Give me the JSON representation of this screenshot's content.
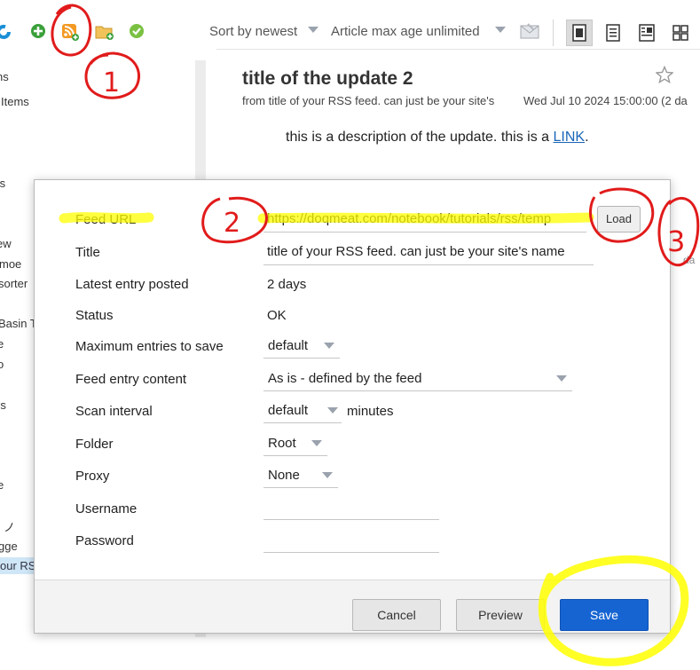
{
  "toolbar": {
    "sort_label": "Sort by newest",
    "age_label": "Article max age unlimited"
  },
  "sidebar": {
    "items": [
      {
        "label": "ns"
      },
      {
        "label": "Items"
      },
      {
        "label": "ts"
      },
      {
        "label": "ew"
      },
      {
        "label": "moe"
      },
      {
        "label": "sorter"
      },
      {
        "label": "t"
      },
      {
        "label": "Basin T"
      },
      {
        "label": "e"
      },
      {
        "label": "o"
      },
      {
        "label": "rs"
      },
      {
        "label": "e"
      },
      {
        "label": ") ノ"
      },
      {
        "label": "gge"
      },
      {
        "label": "our RS"
      }
    ]
  },
  "article": {
    "title": "title of the update 2",
    "source": "from title of your RSS feed. can just be your site's",
    "date": "Wed Jul 10 2024 15:00:00 (2 da",
    "body_text": "this is a description of the update. this is a ",
    "body_link": "LINK",
    "body_end": ".",
    "right_fragment": "da"
  },
  "dialog": {
    "rows": {
      "feed_url": {
        "label": "Feed URL",
        "value": "https://doqmeat.com/notebook/tutorials/rss/temp"
      },
      "title": {
        "label": "Title",
        "value": "title of your RSS feed. can just be your site's name"
      },
      "latest": {
        "label": "Latest entry posted",
        "value": "2 days"
      },
      "status": {
        "label": "Status",
        "value": "OK"
      },
      "max_entries": {
        "label": "Maximum entries to save",
        "value": "default"
      },
      "content": {
        "label": "Feed entry content",
        "value": "As is - defined by the feed"
      },
      "scan": {
        "label": "Scan interval",
        "value": "default",
        "suffix": "minutes"
      },
      "folder": {
        "label": "Folder",
        "value": "Root"
      },
      "proxy": {
        "label": "Proxy",
        "value": "None"
      },
      "username": {
        "label": "Username",
        "value": ""
      },
      "password": {
        "label": "Password",
        "value": ""
      }
    },
    "load_label": "Load",
    "buttons": {
      "cancel": "Cancel",
      "preview": "Preview",
      "save": "Save"
    }
  },
  "annotations": {
    "step1": "1",
    "step2": "2",
    "step3": "3",
    "ink_color": "#e11b1b",
    "highlight_color": "#ffff00"
  },
  "colors": {
    "accent": "#1664d2",
    "link": "#1a66b8"
  }
}
